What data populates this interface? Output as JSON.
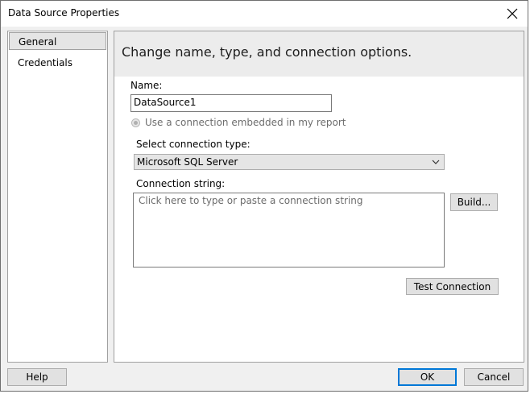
{
  "window": {
    "title": "Data Source Properties",
    "close_icon": "close-icon"
  },
  "nav": {
    "items": [
      {
        "label": "General",
        "selected": true
      },
      {
        "label": "Credentials",
        "selected": false
      }
    ]
  },
  "general": {
    "heading": "Change name, type, and connection options.",
    "name_label": "Name:",
    "name_value": "DataSource1",
    "embedded_radio_label": "Use a connection embedded in my report",
    "connection_type_label": "Select connection type:",
    "connection_type_value": "Microsoft SQL Server",
    "connection_string_label": "Connection string:",
    "connection_string_placeholder": "Click here to type or paste a connection string",
    "build_button": "Build...",
    "test_button": "Test Connection"
  },
  "footer": {
    "help_button": "Help",
    "ok_button": "OK",
    "cancel_button": "Cancel"
  },
  "colors": {
    "default_button_border": "#0078d7",
    "panel_header_bg": "#ececec"
  }
}
